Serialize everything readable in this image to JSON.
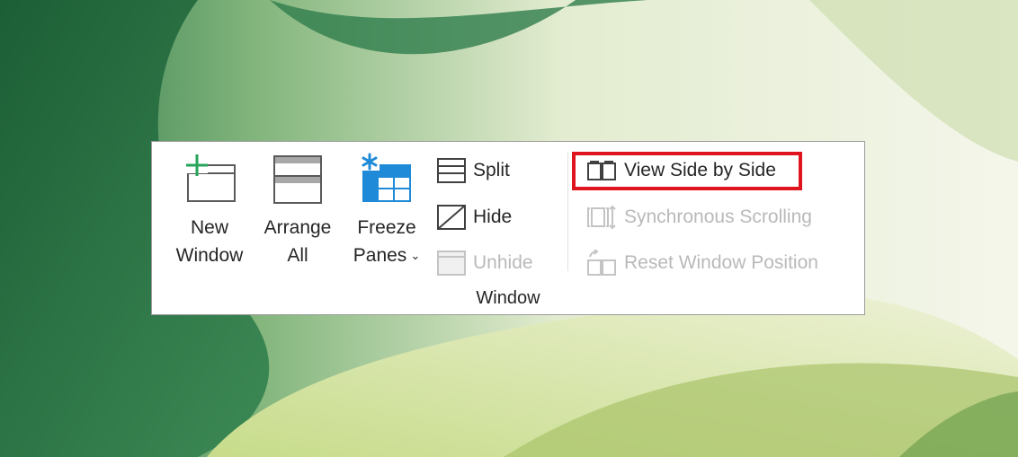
{
  "ribbon": {
    "group_label": "Window",
    "new_window": {
      "line1": "New",
      "line2": "Window",
      "icon": "new-window-icon"
    },
    "arrange_all": {
      "line1": "Arrange",
      "line2": "All",
      "icon": "arrange-all-icon"
    },
    "freeze_panes": {
      "line1": "Freeze",
      "line2": "Panes",
      "caret": "⌄",
      "icon": "freeze-panes-icon"
    },
    "split": {
      "label": "Split",
      "enabled": true,
      "icon": "split-icon"
    },
    "hide": {
      "label": "Hide",
      "enabled": true,
      "icon": "hide-icon"
    },
    "unhide": {
      "label": "Unhide",
      "enabled": false,
      "icon": "unhide-icon"
    },
    "view_side_by_side": {
      "label": "View Side by Side",
      "enabled": true,
      "highlighted": true,
      "icon": "view-side-by-side-icon"
    },
    "synchronous_scrolling": {
      "label": "Synchronous Scrolling",
      "enabled": false,
      "icon": "synchronous-scrolling-icon"
    },
    "reset_window_position": {
      "label": "Reset Window Position",
      "enabled": false,
      "icon": "reset-window-position-icon"
    }
  },
  "colors": {
    "highlight_border": "#e0141e",
    "accent_green": "#27a45a",
    "accent_blue": "#1f8ad8",
    "disabled_text": "#b9b9b9"
  }
}
